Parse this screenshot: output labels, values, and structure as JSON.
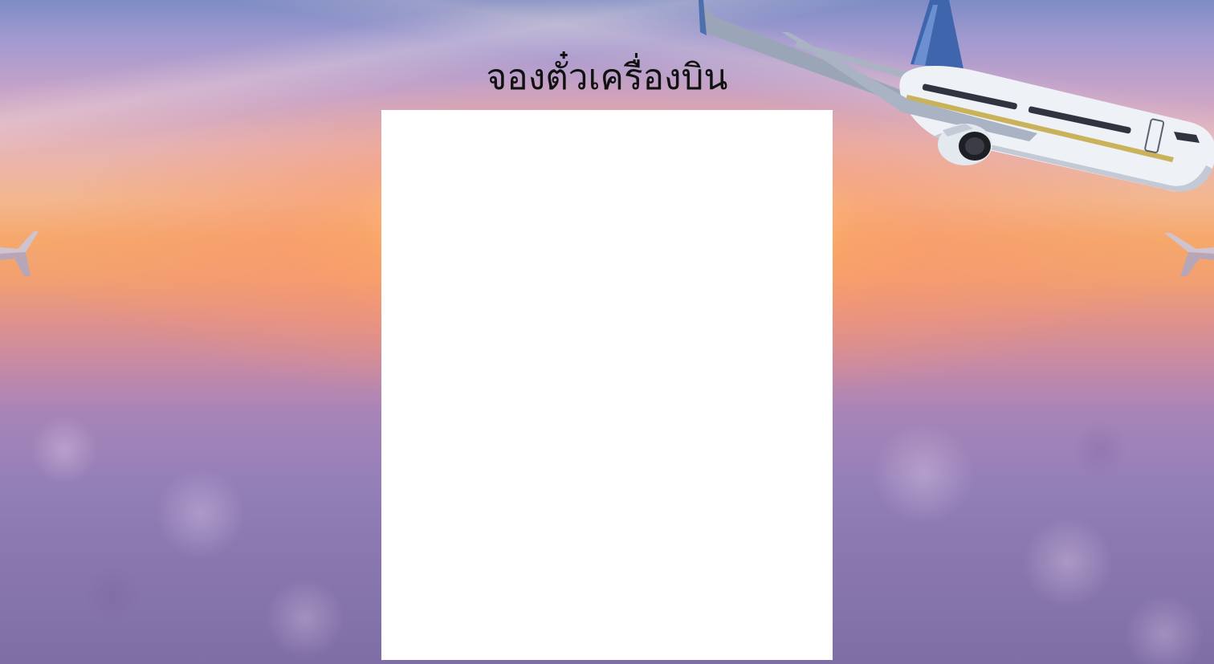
{
  "page": {
    "title": "จองตั๋วเครื่องบิน"
  },
  "background": {
    "image": "sunset-clouds-sky",
    "sky_top_color": "#7d8cc4",
    "sun_color": "#f6a86c",
    "cloud_color": "#9580b8"
  },
  "decoration": {
    "airplane": "airplane-illustration",
    "wingtips": "airplane-wingtip-icon"
  },
  "panel": {
    "background_color": "#ffffff"
  }
}
